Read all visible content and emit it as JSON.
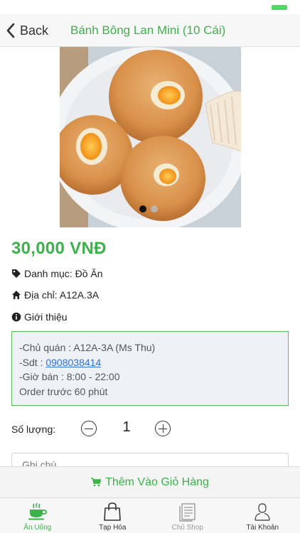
{
  "nav": {
    "back_label": "Back",
    "title": "Bánh Bông Lan Mini (10 Cái)"
  },
  "product": {
    "image_count": 2,
    "active_image": 1,
    "price": "30,000 VNĐ",
    "category": "Danh mục: Đồ Ăn",
    "address": "Địa chỉ: A12A.3A",
    "intro_label": "Giới thiệu",
    "description": {
      "owner": "-Chủ quán : A12A-3A (Ms Thu)",
      "phone_prefix": "-Sdt : ",
      "phone": "0908038414",
      "hours": "-Giờ bán : 8:00 - 22:00",
      "order_note": "Order trước 60 phút"
    }
  },
  "quantity": {
    "label": "Số lượng:",
    "value": "1"
  },
  "note": {
    "placeholder": "Ghi chú"
  },
  "add_to_cart": {
    "label": "Thêm Vào Giỏ Hàng"
  },
  "tabs": [
    {
      "label": "Ăn Uống",
      "icon": "coffee-cup-icon",
      "state": "active"
    },
    {
      "label": "Tạp Hóa",
      "icon": "shopping-bag-icon",
      "state": "normal"
    },
    {
      "label": "Chủ Shop",
      "icon": "document-list-icon",
      "state": "disabled"
    },
    {
      "label": "Tài Khoản",
      "icon": "user-icon",
      "state": "normal"
    }
  ],
  "colors": {
    "accent": "#3cb34a",
    "link": "#2f6fd6",
    "box_border": "#5bbf5c",
    "battery": "#4cd964"
  }
}
